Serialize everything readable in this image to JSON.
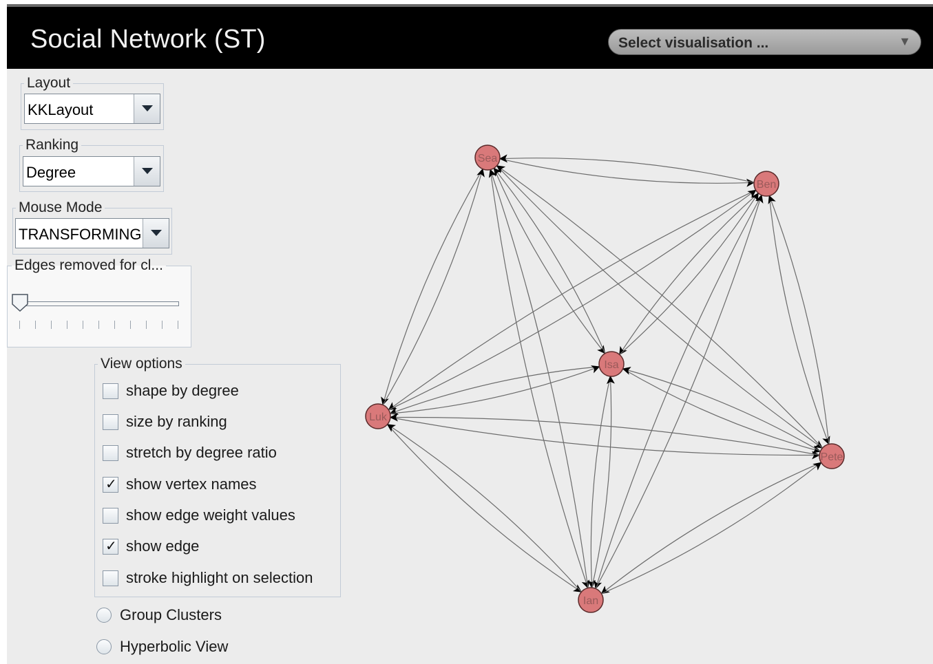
{
  "header": {
    "title": "Social Network (ST)",
    "visualisation_select": "Select visualisation ..."
  },
  "controls": {
    "layout": {
      "label": "Layout",
      "value": "KKLayout"
    },
    "ranking": {
      "label": "Ranking",
      "value": "Degree"
    },
    "mouse_mode": {
      "label": "Mouse Mode",
      "value": "TRANSFORMING"
    },
    "edges_removed": {
      "label": "Edges removed for cl...",
      "value": 0
    }
  },
  "view_options": {
    "label": "View options",
    "items": [
      {
        "label": "shape by degree",
        "checked": false
      },
      {
        "label": "size by ranking",
        "checked": false
      },
      {
        "label": "stretch by degree ratio",
        "checked": false
      },
      {
        "label": "show vertex names",
        "checked": true
      },
      {
        "label": "show edge weight values",
        "checked": false
      },
      {
        "label": "show edge",
        "checked": true
      },
      {
        "label": "stroke highlight on selection",
        "checked": false
      }
    ]
  },
  "radios": [
    {
      "label": "Group Clusters",
      "selected": false
    },
    {
      "label": "Hyperbolic View",
      "selected": false
    }
  ],
  "graph": {
    "vertex_color": "#d9797a",
    "vertices": [
      {
        "id": "A",
        "label": "Sea"
      },
      {
        "id": "B",
        "label": "Ben"
      },
      {
        "id": "C",
        "label": "Isa"
      },
      {
        "id": "D",
        "label": "Luk"
      },
      {
        "id": "E",
        "label": "Pete"
      },
      {
        "id": "F",
        "label": "Ian"
      }
    ]
  }
}
